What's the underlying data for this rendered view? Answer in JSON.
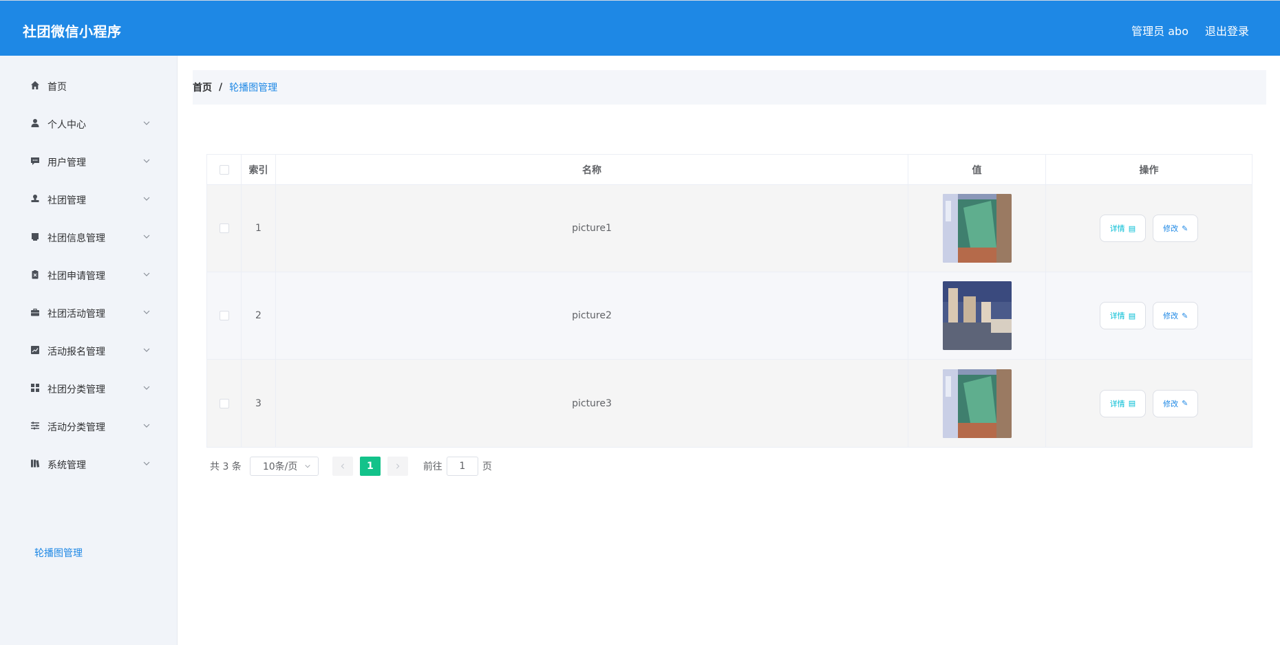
{
  "header": {
    "title": "社团微信小程序",
    "user_label": "管理员 abo",
    "logout": "退出登录"
  },
  "sidebar": {
    "items": [
      {
        "label": "首页",
        "icon": "home-icon"
      },
      {
        "label": "个人中心",
        "icon": "user-icon"
      },
      {
        "label": "用户管理",
        "icon": "chat-icon"
      },
      {
        "label": "社团管理",
        "icon": "stamp-icon"
      },
      {
        "label": "社团信息管理",
        "icon": "inbox-icon"
      },
      {
        "label": "社团申请管理",
        "icon": "clipboard-icon"
      },
      {
        "label": "社团活动管理",
        "icon": "briefcase-icon"
      },
      {
        "label": "活动报名管理",
        "icon": "chart-icon"
      },
      {
        "label": "社团分类管理",
        "icon": "grid-icon"
      },
      {
        "label": "活动分类管理",
        "icon": "sliders-icon"
      },
      {
        "label": "系统管理",
        "icon": "book-icon"
      }
    ],
    "active_sub": "轮播图管理"
  },
  "breadcrumb": {
    "home": "首页",
    "sep": "/",
    "current": "轮播图管理"
  },
  "table": {
    "headers": {
      "index": "索引",
      "name": "名称",
      "value": "值",
      "ops": "操作"
    },
    "rows": [
      {
        "index": "1",
        "name": "picture1"
      },
      {
        "index": "2",
        "name": "picture2"
      },
      {
        "index": "3",
        "name": "picture3"
      }
    ],
    "detail_label": "详情",
    "edit_label": "修改"
  },
  "pagination": {
    "total": "共 3 条",
    "page_size": "10条/页",
    "current_page": "1",
    "goto_label": "前往",
    "goto_value": "1",
    "page_suffix": "页"
  },
  "colors": {
    "header": "#1e88e5",
    "accent": "#1e88e5",
    "pager_active": "#13c28a",
    "detail": "#00bcd4"
  }
}
